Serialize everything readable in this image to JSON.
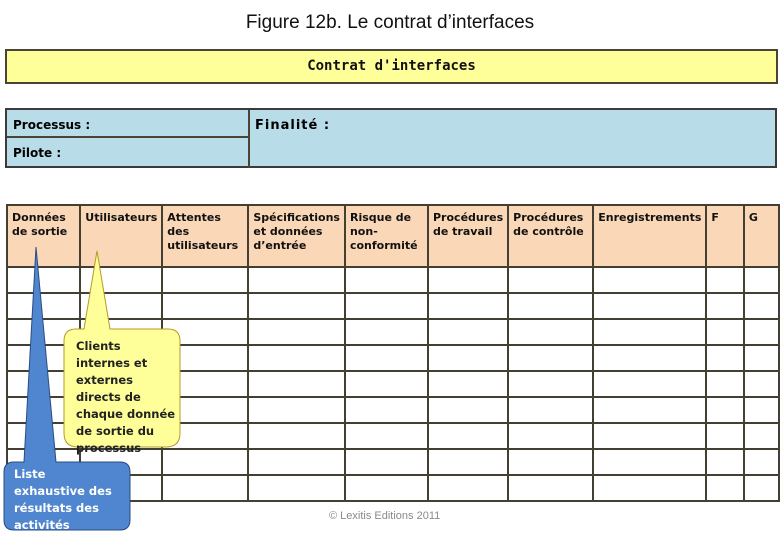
{
  "figure_title": "Figure 12b. Le contrat d’interfaces",
  "banner_title": "Contrat d'interfaces",
  "info": {
    "processus_label": "Processus :",
    "pilote_label": "Pilote :",
    "finalite_label": "Finalité :"
  },
  "table": {
    "headers": [
      "Données de sortie",
      "Utilisateurs",
      "Attentes des utilisateurs",
      "Spécifications et données d’entrée",
      "Risque de non-conformité",
      "Procédures de travail",
      "Procédures de contrôle",
      "Enregistrements",
      "F",
      "G"
    ],
    "empty_rows": 9
  },
  "callouts": {
    "utilisateurs": "Clients internes et externes directs de chaque donnée de sortie du processus",
    "donnees_sortie": "Liste exhaustive des résultats des activités internes"
  },
  "copyright": "© Lexitis Editions 2011",
  "colors": {
    "banner": "#ffff99",
    "info_panel": "#b8dde8",
    "table_header": "#fad7b6",
    "callout_yellow": "#ffff99",
    "callout_blue": "#4f86cf"
  }
}
